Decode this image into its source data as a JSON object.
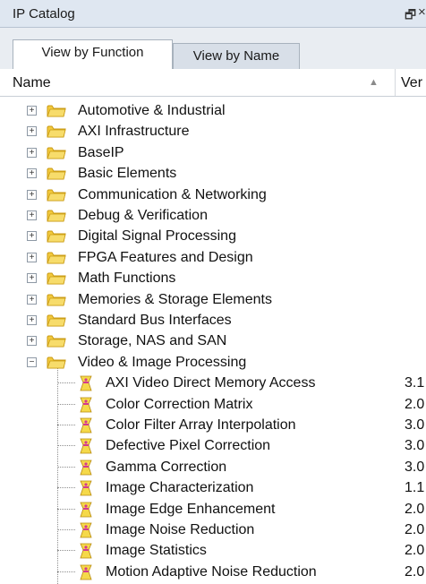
{
  "panel": {
    "title": "IP Catalog",
    "pin_glyph": "🗗",
    "close_glyph": "×"
  },
  "tabs": [
    {
      "label": "View by Function",
      "active": true
    },
    {
      "label": "View by Name",
      "active": false
    }
  ],
  "columns": {
    "name": "Name",
    "version": "Ver",
    "sort_glyph": "▲"
  },
  "categories": [
    {
      "label": "Automotive & Industrial",
      "expanded": false
    },
    {
      "label": "AXI Infrastructure",
      "expanded": false
    },
    {
      "label": "BaseIP",
      "expanded": false
    },
    {
      "label": "Basic Elements",
      "expanded": false
    },
    {
      "label": "Communication & Networking",
      "expanded": false
    },
    {
      "label": "Debug & Verification",
      "expanded": false
    },
    {
      "label": "Digital Signal Processing",
      "expanded": false
    },
    {
      "label": "FPGA Features and Design",
      "expanded": false
    },
    {
      "label": "Math Functions",
      "expanded": false
    },
    {
      "label": "Memories & Storage Elements",
      "expanded": false
    },
    {
      "label": "Standard Bus Interfaces",
      "expanded": false
    },
    {
      "label": "Storage, NAS and SAN",
      "expanded": false
    },
    {
      "label": "Video & Image Processing",
      "expanded": true
    }
  ],
  "ip_cores": [
    {
      "label": "AXI Video Direct Memory Access",
      "version": "3.1"
    },
    {
      "label": "Color Correction Matrix",
      "version": "2.0"
    },
    {
      "label": "Color Filter Array Interpolation",
      "version": "3.0"
    },
    {
      "label": "Defective Pixel Correction",
      "version": "3.0"
    },
    {
      "label": "Gamma Correction",
      "version": "3.0"
    },
    {
      "label": "Image Characterization",
      "version": "1.1"
    },
    {
      "label": "Image Edge Enhancement",
      "version": "2.0"
    },
    {
      "label": "Image Noise Reduction",
      "version": "2.0"
    },
    {
      "label": "Image Statistics",
      "version": "2.0"
    },
    {
      "label": "Motion Adaptive Noise Reduction",
      "version": "2.0"
    }
  ],
  "colors": {
    "folder": "#f2c93d",
    "folder_dark": "#c99a12",
    "ip_icon": "#f5d94a",
    "ip_icon_accent": "#d33a8f"
  }
}
